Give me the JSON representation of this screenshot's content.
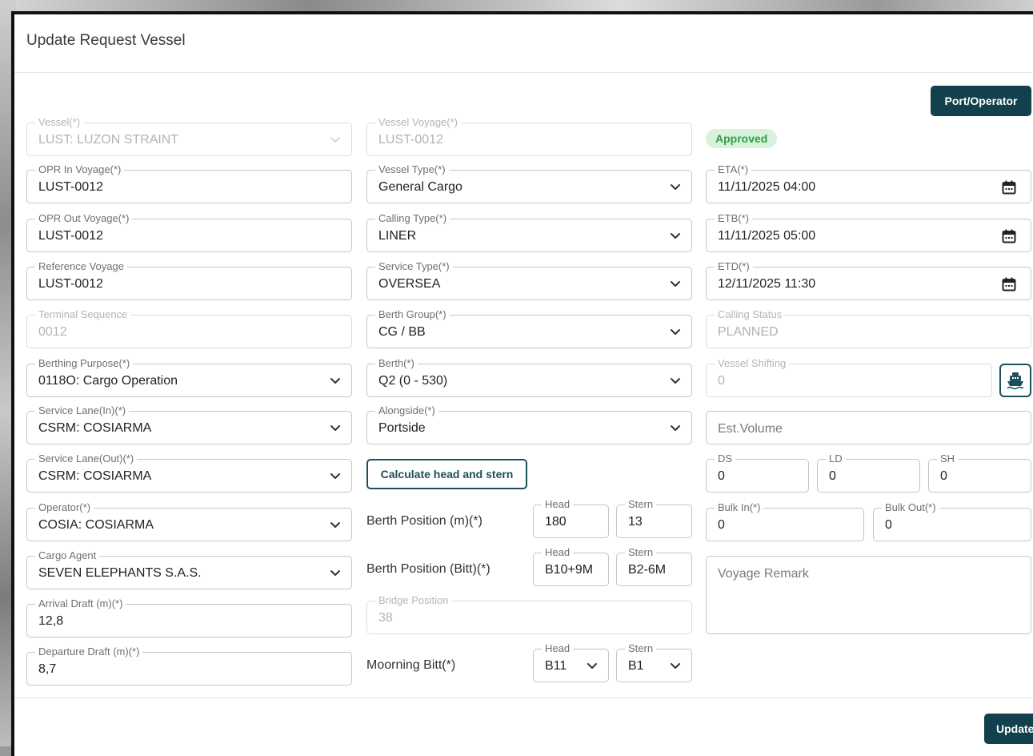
{
  "dialog": {
    "title": "Update Request Vessel",
    "close_glyph": "×"
  },
  "actions": {
    "port_operator": "Port/Operator",
    "calculate": "Calculate head and stern",
    "update": "Update"
  },
  "status": {
    "approved": "Approved"
  },
  "fields": {
    "vessel": {
      "label": "Vessel(*)",
      "value": "LUST: LUZON STRAINT"
    },
    "vessel_voyage": {
      "label": "Vessel Voyage(*)",
      "value": "LUST-0012"
    },
    "opr_in_voyage": {
      "label": "OPR In Voyage(*)",
      "value": "LUST-0012"
    },
    "vessel_type": {
      "label": "Vessel Type(*)",
      "value": "General Cargo"
    },
    "eta": {
      "label": "ETA(*)",
      "value": "11/11/2025 04:00"
    },
    "opr_out_voyage": {
      "label": "OPR Out Voyage(*)",
      "value": "LUST-0012"
    },
    "calling_type": {
      "label": "Calling Type(*)",
      "value": "LINER"
    },
    "etb": {
      "label": "ETB(*)",
      "value": "11/11/2025 05:00"
    },
    "reference_voyage": {
      "label": "Reference Voyage",
      "value": "LUST-0012"
    },
    "service_type": {
      "label": "Service Type(*)",
      "value": "OVERSEA"
    },
    "etd": {
      "label": "ETD(*)",
      "value": "12/11/2025 11:30"
    },
    "terminal_sequence": {
      "label": "Terminal Sequence",
      "value": "0012"
    },
    "berth_group": {
      "label": "Berth Group(*)",
      "value": "CG / BB"
    },
    "calling_status": {
      "label": "Calling Status",
      "value": "PLANNED"
    },
    "berthing_purpose": {
      "label": "Berthing Purpose(*)",
      "value": "0118O: Cargo Operation"
    },
    "berth": {
      "label": "Berth(*)",
      "value": "Q2 (0 - 530)"
    },
    "vessel_shifting": {
      "label": "Vessel Shifting",
      "value": "0"
    },
    "service_lane_in": {
      "label": "Service Lane(In)(*)",
      "value": "CSRM: COSIARMA"
    },
    "alongside": {
      "label": "Alongside(*)",
      "value": "Portside"
    },
    "est_volume": {
      "placeholder": "Est.Volume"
    },
    "service_lane_out": {
      "label": "Service Lane(Out)(*)",
      "value": "CSRM: COSIARMA"
    },
    "ds": {
      "label": "DS",
      "value": "0"
    },
    "ld": {
      "label": "LD",
      "value": "0"
    },
    "sh": {
      "label": "SH",
      "value": "0"
    },
    "operator": {
      "label": "Operator(*)",
      "value": "COSIA: COSIARMA"
    },
    "bulk_in": {
      "label": "Bulk In(*)",
      "value": "0"
    },
    "bulk_out": {
      "label": "Bulk Out(*)",
      "value": "0"
    },
    "cargo_agent": {
      "label": "Cargo Agent",
      "value": "SEVEN ELEPHANTS S.A.S."
    },
    "voyage_remark": {
      "placeholder": "Voyage Remark"
    },
    "arrival_draft": {
      "label": "Arrival Draft (m)(*)",
      "value": "12,8"
    },
    "bridge_position": {
      "label": "Bridge Position",
      "value": "38"
    },
    "departure_draft": {
      "label": "Departure Draft (m)(*)",
      "value": "8,7"
    }
  },
  "berth_position_m": {
    "label": "Berth Position (m)(*)",
    "head_label": "Head",
    "head": "180",
    "stern_label": "Stern",
    "stern": "13"
  },
  "berth_position_bitt": {
    "label": "Berth Position (Bitt)(*)",
    "head_label": "Head",
    "head": "B10+9M",
    "stern_label": "Stern",
    "stern": "B2-6M"
  },
  "moorning_bitt": {
    "label": "Moorning Bitt(*)",
    "head_label": "Head",
    "head": "B11",
    "stern_label": "Stern",
    "stern": "B1"
  },
  "colors": {
    "primary": "#12404d",
    "approved_bg": "#d9f2dc",
    "approved_text": "#2ea043"
  }
}
